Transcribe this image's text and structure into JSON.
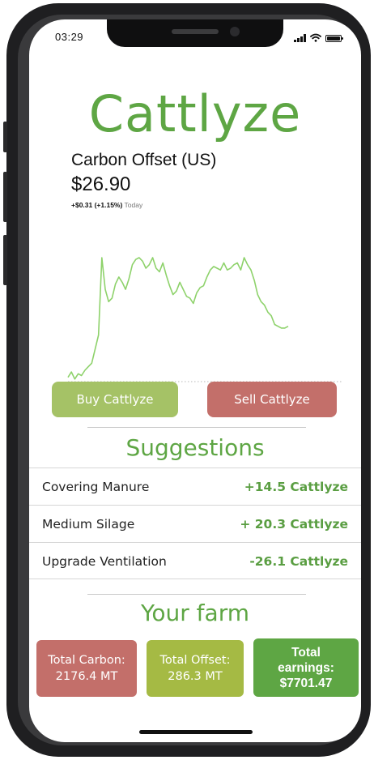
{
  "status_bar": {
    "time": "03:29"
  },
  "app": {
    "title": "Cattlyze"
  },
  "stock": {
    "name": "Carbon Offset (US)",
    "price": "$26.90",
    "change": "+$0.31 (+1.15%)",
    "period": "Today"
  },
  "chart_data": {
    "type": "line",
    "series": [
      {
        "values": [
          2,
          5,
          1,
          4,
          3,
          6,
          8,
          10,
          18,
          26,
          70,
          52,
          45,
          47,
          55,
          59,
          56,
          52,
          58,
          66,
          69,
          70,
          68,
          64,
          66,
          70,
          64,
          62,
          67,
          60,
          54,
          49,
          51,
          56,
          52,
          48,
          47,
          44,
          50,
          53,
          54,
          59,
          63,
          65,
          64,
          63,
          67,
          63,
          64,
          66,
          67,
          63,
          70,
          66,
          63,
          57,
          49,
          45,
          43,
          39,
          37,
          32,
          31,
          30,
          30,
          31
        ]
      }
    ],
    "baseline_dotted": true,
    "line_color": "#8ed26b"
  },
  "actions": {
    "buy_label": "Buy Cattlyze",
    "sell_label": "Sell Cattlyze"
  },
  "suggestions": {
    "title": "Suggestions",
    "items": [
      {
        "label": "Covering Manure",
        "value": "+14.5 Cattlyze"
      },
      {
        "label": "Medium Silage",
        "value": "+ 20.3 Cattlyze"
      },
      {
        "label": "Upgrade Ventilation",
        "value": "-26.1 Cattlyze"
      }
    ]
  },
  "farm": {
    "title": "Your farm",
    "total_carbon": {
      "label": "Total Carbon:",
      "value": "2176.4 MT"
    },
    "total_offset": {
      "label": "Total Offset:",
      "value": "286.3 MT"
    },
    "total_earnings": {
      "label": "Total earnings:",
      "value": "$7701.47"
    }
  },
  "colors": {
    "brand_green": "#5ea644",
    "buy_button": "#a5c266",
    "sell_button": "#c36f6a",
    "offset_card": "#a5ba44"
  }
}
